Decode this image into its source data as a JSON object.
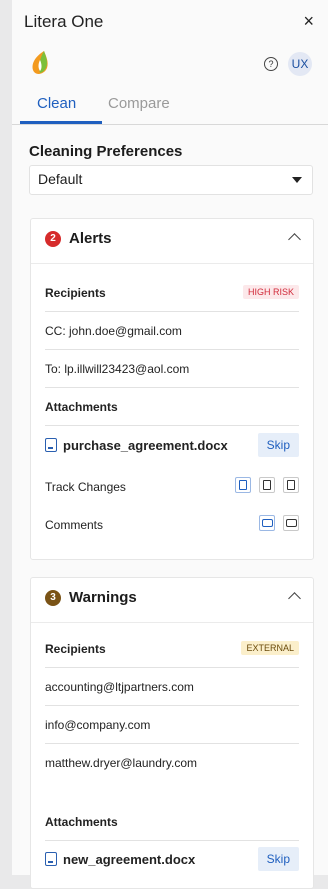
{
  "app": {
    "title": "Litera One",
    "close_glyph": "×"
  },
  "header": {
    "help_glyph": "?",
    "avatar_initials": "UX"
  },
  "tabs": [
    {
      "label": "Clean",
      "active": true
    },
    {
      "label": "Compare",
      "active": false
    }
  ],
  "preferences": {
    "label": "Cleaning Preferences",
    "selected": "Default"
  },
  "alerts": {
    "count": "2",
    "title": "Alerts",
    "recipients_label": "Recipients",
    "risk_tag": "HIGH RISK",
    "recipients": [
      "CC:  john.doe@gmail.com",
      "To: lp.illwill23423@aol.com"
    ],
    "attachments_label": "Attachments",
    "file": "purchase_agreement.docx",
    "skip_label": "Skip",
    "track_changes_label": "Track Changes",
    "comments_label": "Comments"
  },
  "warnings": {
    "count": "3",
    "title": "Warnings",
    "recipients_label": "Recipients",
    "tag": "EXTERNAL",
    "recipients": [
      "accounting@ltjpartners.com",
      "info@company.com",
      "matthew.dryer@laundry.com"
    ],
    "attachments_label": "Attachments",
    "file": "new_agreement.docx",
    "skip_label": "Skip"
  },
  "colors": {
    "accent": "#1f5fbf",
    "alert_red": "#d62b2b",
    "warning_brown": "#7a5316"
  }
}
